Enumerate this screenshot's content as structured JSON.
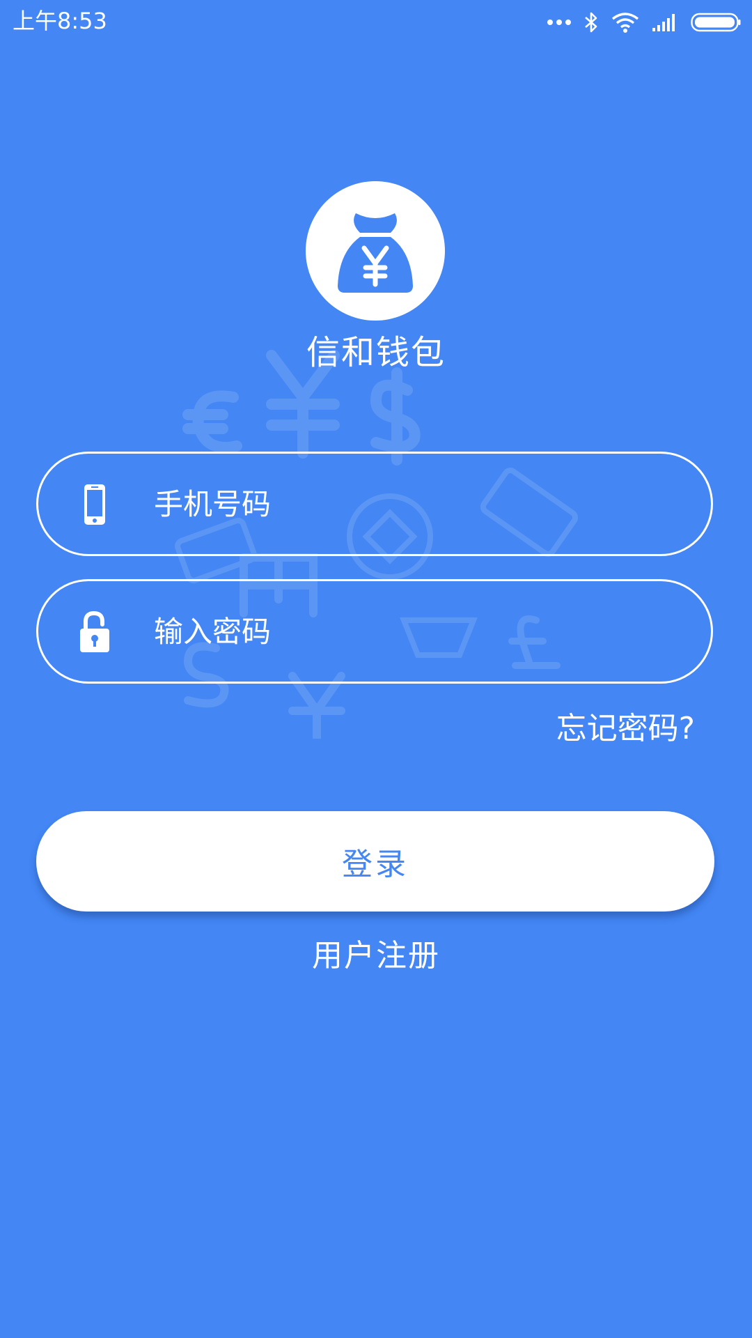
{
  "status_bar": {
    "time": "上午8:53",
    "icons": [
      "more-icon",
      "bluetooth-icon",
      "wifi-icon",
      "signal-icon",
      "battery-icon"
    ]
  },
  "colors": {
    "background": "#4386f4",
    "accent": "#4386f4",
    "surface": "#ffffff"
  },
  "logo": {
    "icon": "money-bag-yen-icon",
    "app_name": "信和钱包"
  },
  "form": {
    "phone": {
      "icon": "phone-icon",
      "placeholder": "手机号码",
      "value": ""
    },
    "password": {
      "icon": "unlock-icon",
      "placeholder": "输入密码",
      "value": ""
    },
    "forgot_label": "忘记密码?",
    "login_label": "登录",
    "register_label": "用户注册"
  }
}
